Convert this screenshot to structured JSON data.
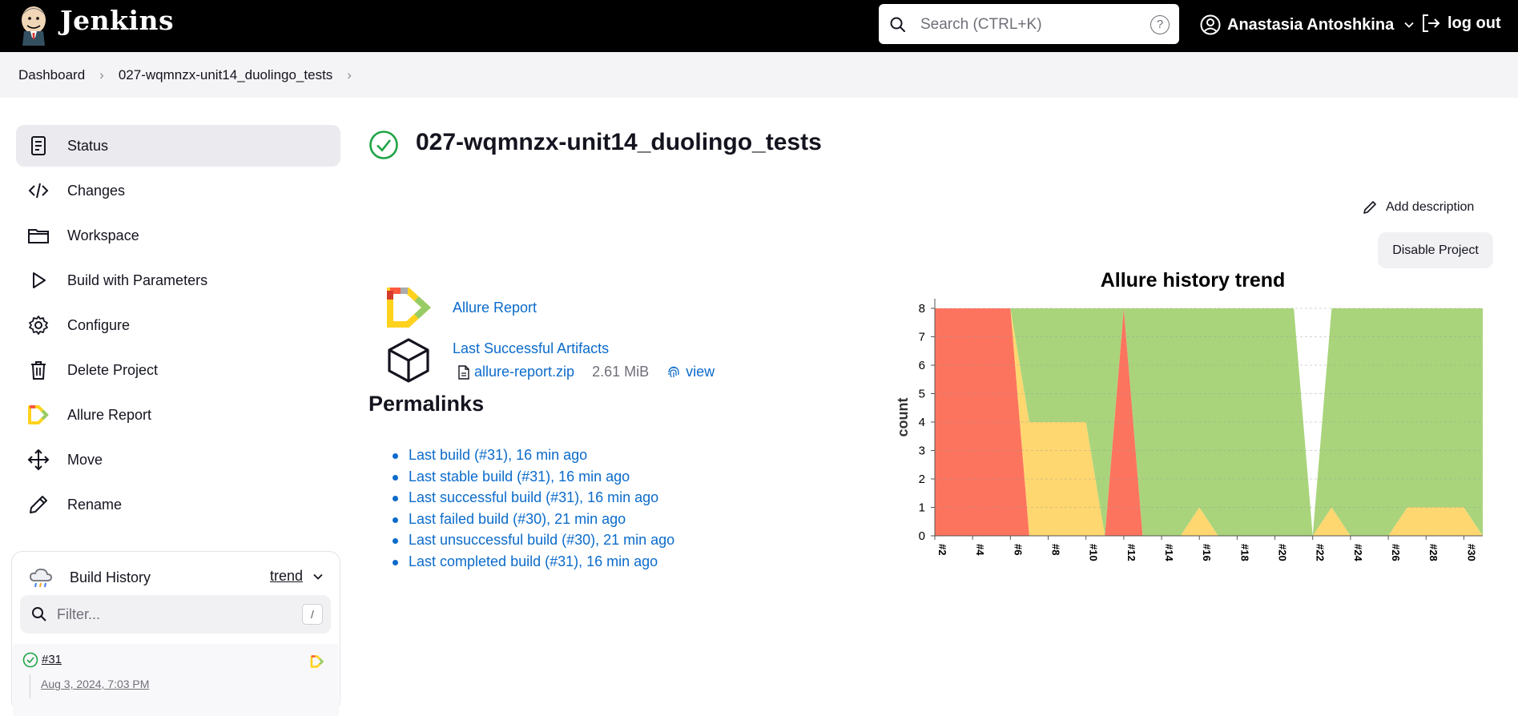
{
  "header": {
    "brand": "Jenkins",
    "search_placeholder": "Search (CTRL+K)",
    "help_label": "?",
    "user_name": "Anastasia Antoshkina",
    "logout_label": "log out"
  },
  "breadcrumb": [
    "Dashboard",
    "027-wqmnzx-unit14_duolingo_tests"
  ],
  "sidebar": {
    "items": [
      {
        "label": "Status",
        "icon": "status-icon"
      },
      {
        "label": "Changes",
        "icon": "code-icon"
      },
      {
        "label": "Workspace",
        "icon": "folder-icon"
      },
      {
        "label": "Build with Parameters",
        "icon": "play-icon"
      },
      {
        "label": "Configure",
        "icon": "gear-icon"
      },
      {
        "label": "Delete Project",
        "icon": "trash-icon"
      },
      {
        "label": "Allure Report",
        "icon": "allure-icon"
      },
      {
        "label": "Move",
        "icon": "move-icon"
      },
      {
        "label": "Rename",
        "icon": "pencil-icon"
      }
    ]
  },
  "build_history": {
    "title": "Build History",
    "trend_label": "trend",
    "filter_placeholder": "Filter...",
    "filter_shortcut": "/",
    "builds": [
      {
        "number": "#31",
        "date": "Aug 3, 2024, 7:03 PM",
        "status": "success"
      }
    ]
  },
  "main": {
    "title": "027-wqmnzx-unit14_duolingo_tests",
    "add_description": "Add description",
    "disable_button": "Disable Project",
    "allure_report_link": "Allure Report",
    "artifacts_link": "Last Successful Artifacts",
    "artifact_file": "allure-report.zip",
    "artifact_size": "2.61 MiB",
    "artifact_view": "view",
    "permalinks_title": "Permalinks",
    "permalinks": [
      "Last build (#31), 16 min ago",
      "Last stable build (#31), 16 min ago",
      "Last successful build (#31), 16 min ago",
      "Last failed build (#30), 21 min ago",
      "Last unsuccessful build (#30), 21 min ago",
      "Last completed build (#31), 16 min ago"
    ]
  },
  "colors": {
    "accent_link": "#0b6bcb",
    "success": "#1ea446",
    "failed": "#fd745e",
    "broken": "#ffd770",
    "passed": "#a9d47b"
  },
  "chart_data": {
    "type": "area",
    "title": "Allure history trend",
    "ylabel": "count",
    "xlabel": "",
    "ylim": [
      0,
      8
    ],
    "yticks": [
      0,
      1,
      2,
      3,
      4,
      5,
      6,
      7,
      8
    ],
    "x": [
      "#2",
      "#3",
      "#4",
      "#5",
      "#6",
      "#7",
      "#8",
      "#9",
      "#10",
      "#11",
      "#12",
      "#13",
      "#14",
      "#15",
      "#16",
      "#17",
      "#18",
      "#19",
      "#20",
      "#21",
      "#22",
      "#23",
      "#24",
      "#25",
      "#26",
      "#27",
      "#28",
      "#29",
      "#30",
      "#31"
    ],
    "x_tick_labels": [
      "#2",
      "#4",
      "#6",
      "#8",
      "#10",
      "#12",
      "#14",
      "#16",
      "#18",
      "#20",
      "#22",
      "#24",
      "#26",
      "#28",
      "#30"
    ],
    "stacked": true,
    "grid": true,
    "series": [
      {
        "color": "#fd745e",
        "values": [
          8,
          8,
          8,
          8,
          8,
          0,
          0,
          0,
          0,
          0,
          8,
          0,
          0,
          0,
          0,
          0,
          0,
          0,
          0,
          0,
          0,
          0,
          0,
          0,
          0,
          0,
          0,
          0,
          0,
          0
        ]
      },
      {
        "color": "#ffd770",
        "values": [
          0,
          0,
          0,
          0,
          0,
          4,
          4,
          4,
          4,
          0,
          0,
          0,
          0,
          0,
          1,
          0,
          0,
          0,
          0,
          0,
          0,
          1,
          0,
          0,
          0,
          1,
          1,
          1,
          1,
          0
        ]
      },
      {
        "color": "#a9d47b",
        "values": [
          0,
          0,
          0,
          0,
          0,
          4,
          4,
          4,
          4,
          8,
          0,
          8,
          8,
          8,
          7,
          8,
          8,
          8,
          8,
          8,
          0,
          7,
          8,
          8,
          8,
          7,
          7,
          7,
          7,
          8
        ]
      }
    ]
  }
}
